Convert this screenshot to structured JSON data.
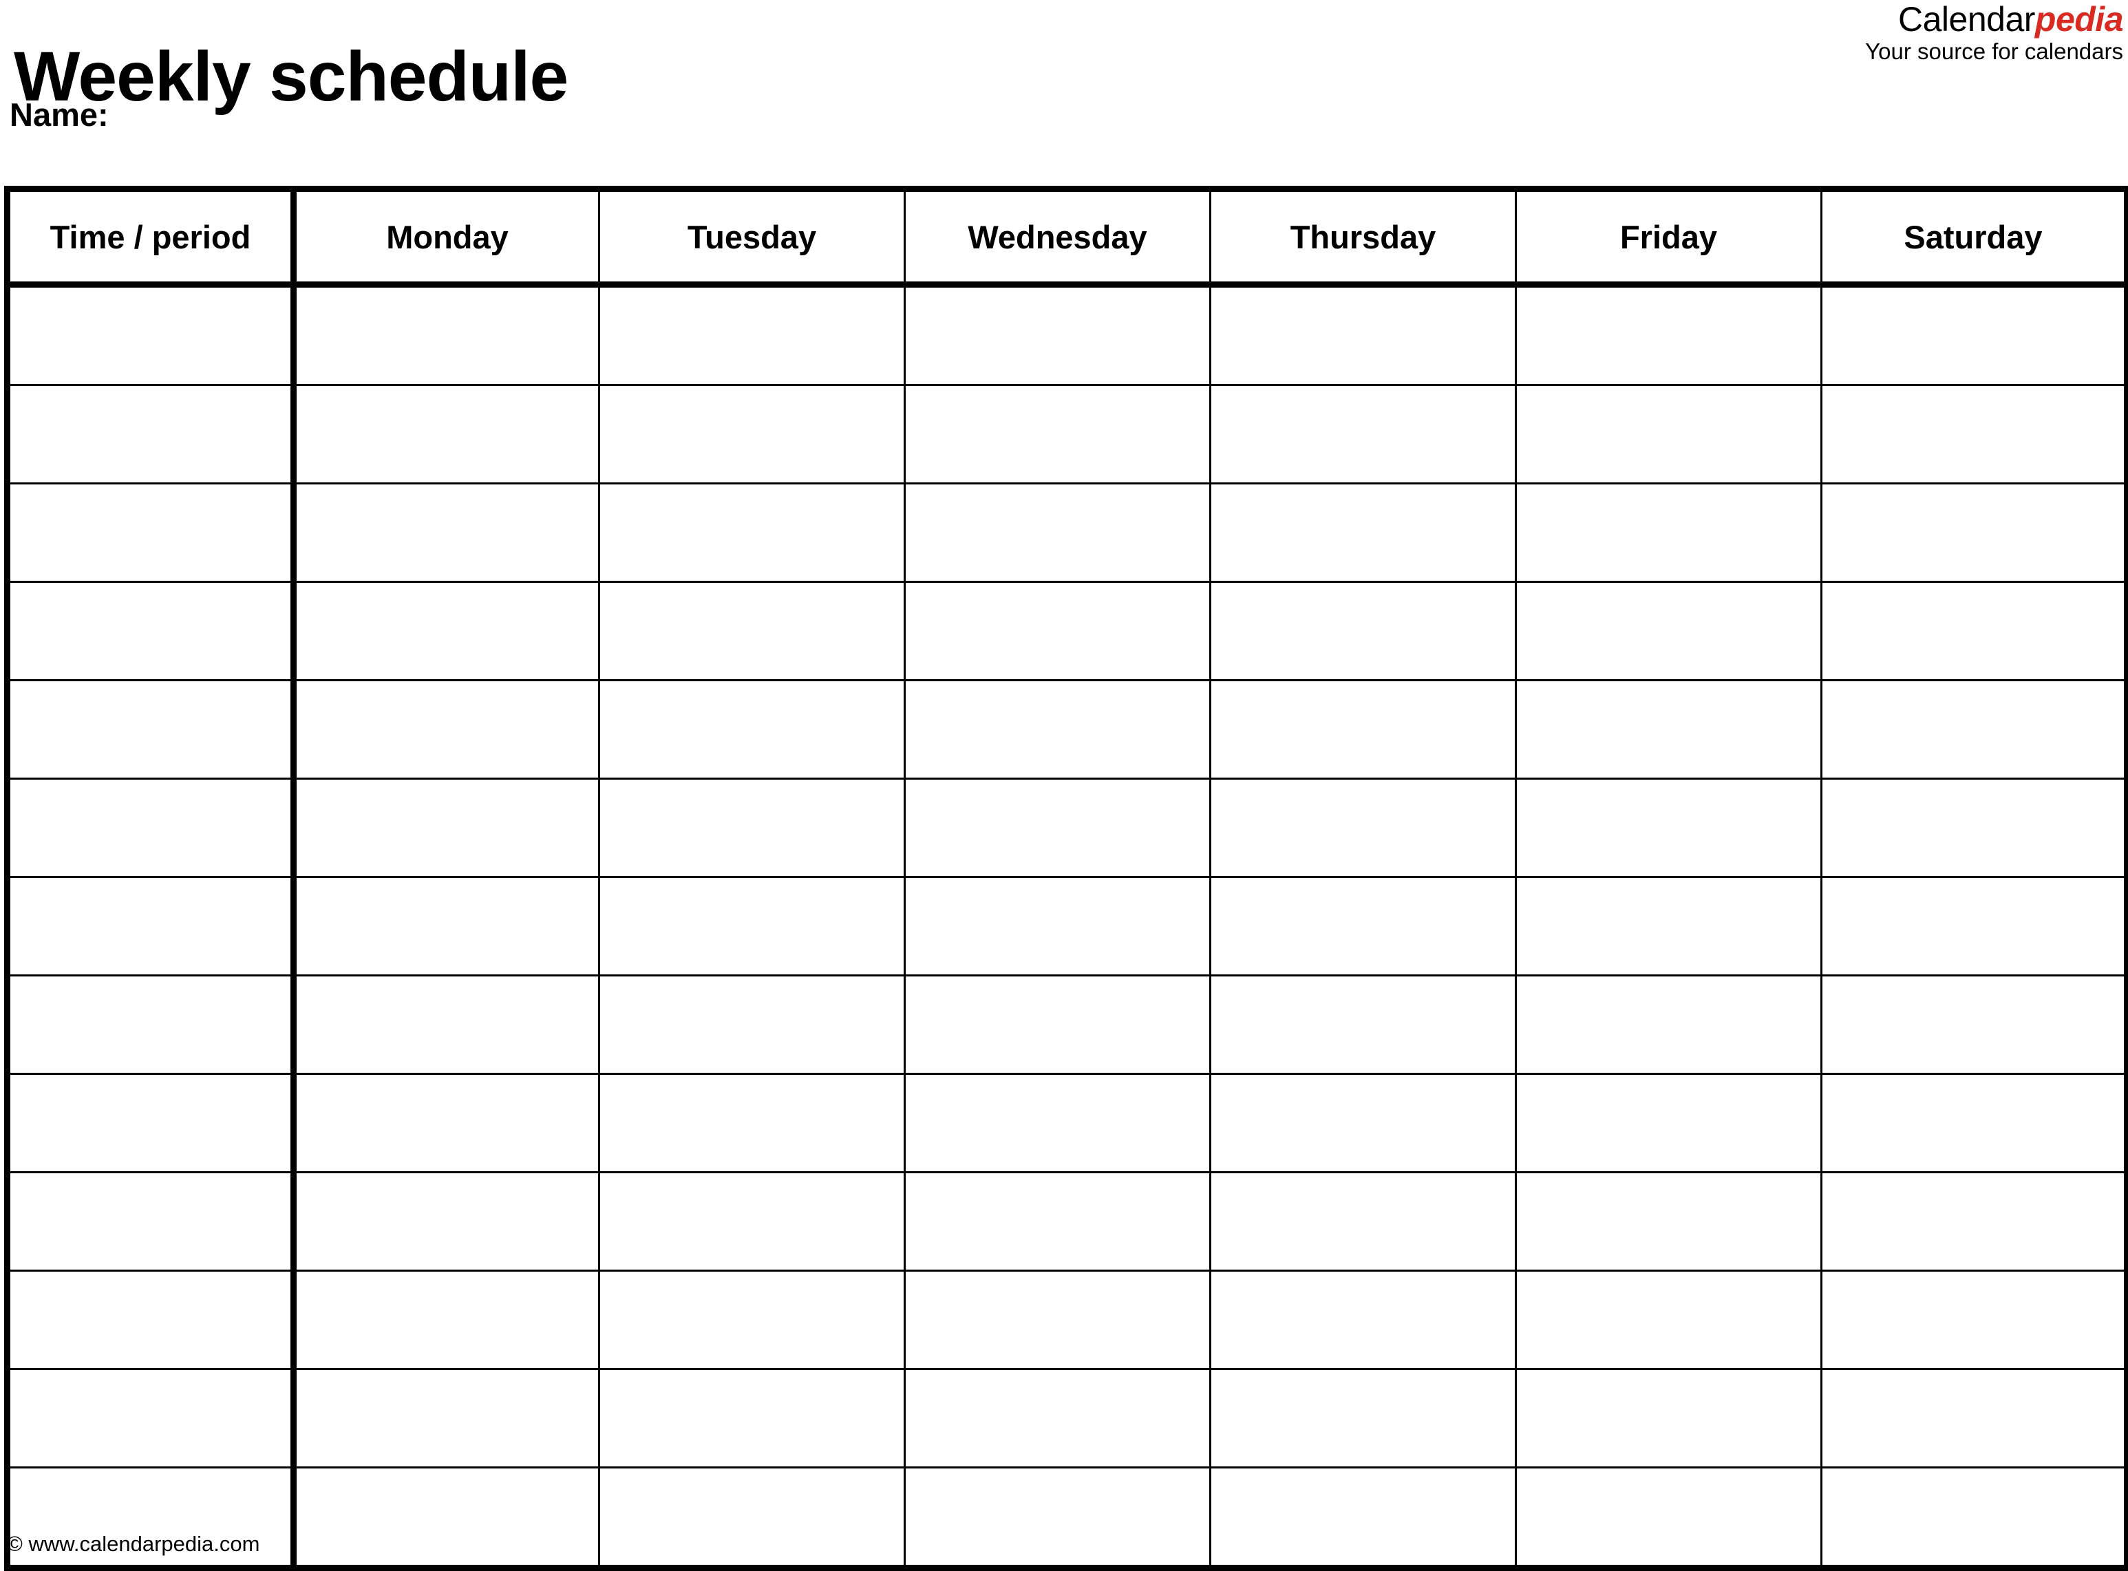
{
  "document": {
    "title": "Weekly schedule",
    "name_label": "Name:"
  },
  "brand": {
    "word_primary": "Calendar",
    "word_accent": "pedia",
    "tagline": "Your source for calendars",
    "accent_color": "#D92B22",
    "primary_color": "#000000"
  },
  "table": {
    "columns": [
      {
        "key": "time",
        "label": "Time / period"
      },
      {
        "key": "monday",
        "label": "Monday"
      },
      {
        "key": "tuesday",
        "label": "Tuesday"
      },
      {
        "key": "wednesday",
        "label": "Wednesday"
      },
      {
        "key": "thursday",
        "label": "Thursday"
      },
      {
        "key": "friday",
        "label": "Friday"
      },
      {
        "key": "saturday",
        "label": "Saturday"
      }
    ],
    "row_count": 13,
    "rows": [
      {
        "time": "",
        "monday": "",
        "tuesday": "",
        "wednesday": "",
        "thursday": "",
        "friday": "",
        "saturday": ""
      },
      {
        "time": "",
        "monday": "",
        "tuesday": "",
        "wednesday": "",
        "thursday": "",
        "friday": "",
        "saturday": ""
      },
      {
        "time": "",
        "monday": "",
        "tuesday": "",
        "wednesday": "",
        "thursday": "",
        "friday": "",
        "saturday": ""
      },
      {
        "time": "",
        "monday": "",
        "tuesday": "",
        "wednesday": "",
        "thursday": "",
        "friday": "",
        "saturday": ""
      },
      {
        "time": "",
        "monday": "",
        "tuesday": "",
        "wednesday": "",
        "thursday": "",
        "friday": "",
        "saturday": ""
      },
      {
        "time": "",
        "monday": "",
        "tuesday": "",
        "wednesday": "",
        "thursday": "",
        "friday": "",
        "saturday": ""
      },
      {
        "time": "",
        "monday": "",
        "tuesday": "",
        "wednesday": "",
        "thursday": "",
        "friday": "",
        "saturday": ""
      },
      {
        "time": "",
        "monday": "",
        "tuesday": "",
        "wednesday": "",
        "thursday": "",
        "friday": "",
        "saturday": ""
      },
      {
        "time": "",
        "monday": "",
        "tuesday": "",
        "wednesday": "",
        "thursday": "",
        "friday": "",
        "saturday": ""
      },
      {
        "time": "",
        "monday": "",
        "tuesday": "",
        "wednesday": "",
        "thursday": "",
        "friday": "",
        "saturday": ""
      },
      {
        "time": "",
        "monday": "",
        "tuesday": "",
        "wednesday": "",
        "thursday": "",
        "friday": "",
        "saturday": ""
      },
      {
        "time": "",
        "monday": "",
        "tuesday": "",
        "wednesday": "",
        "thursday": "",
        "friday": "",
        "saturday": ""
      },
      {
        "time": "",
        "monday": "",
        "tuesday": "",
        "wednesday": "",
        "thursday": "",
        "friday": "",
        "saturday": ""
      }
    ]
  },
  "footer": {
    "copyright": "© www.calendarpedia.com"
  }
}
